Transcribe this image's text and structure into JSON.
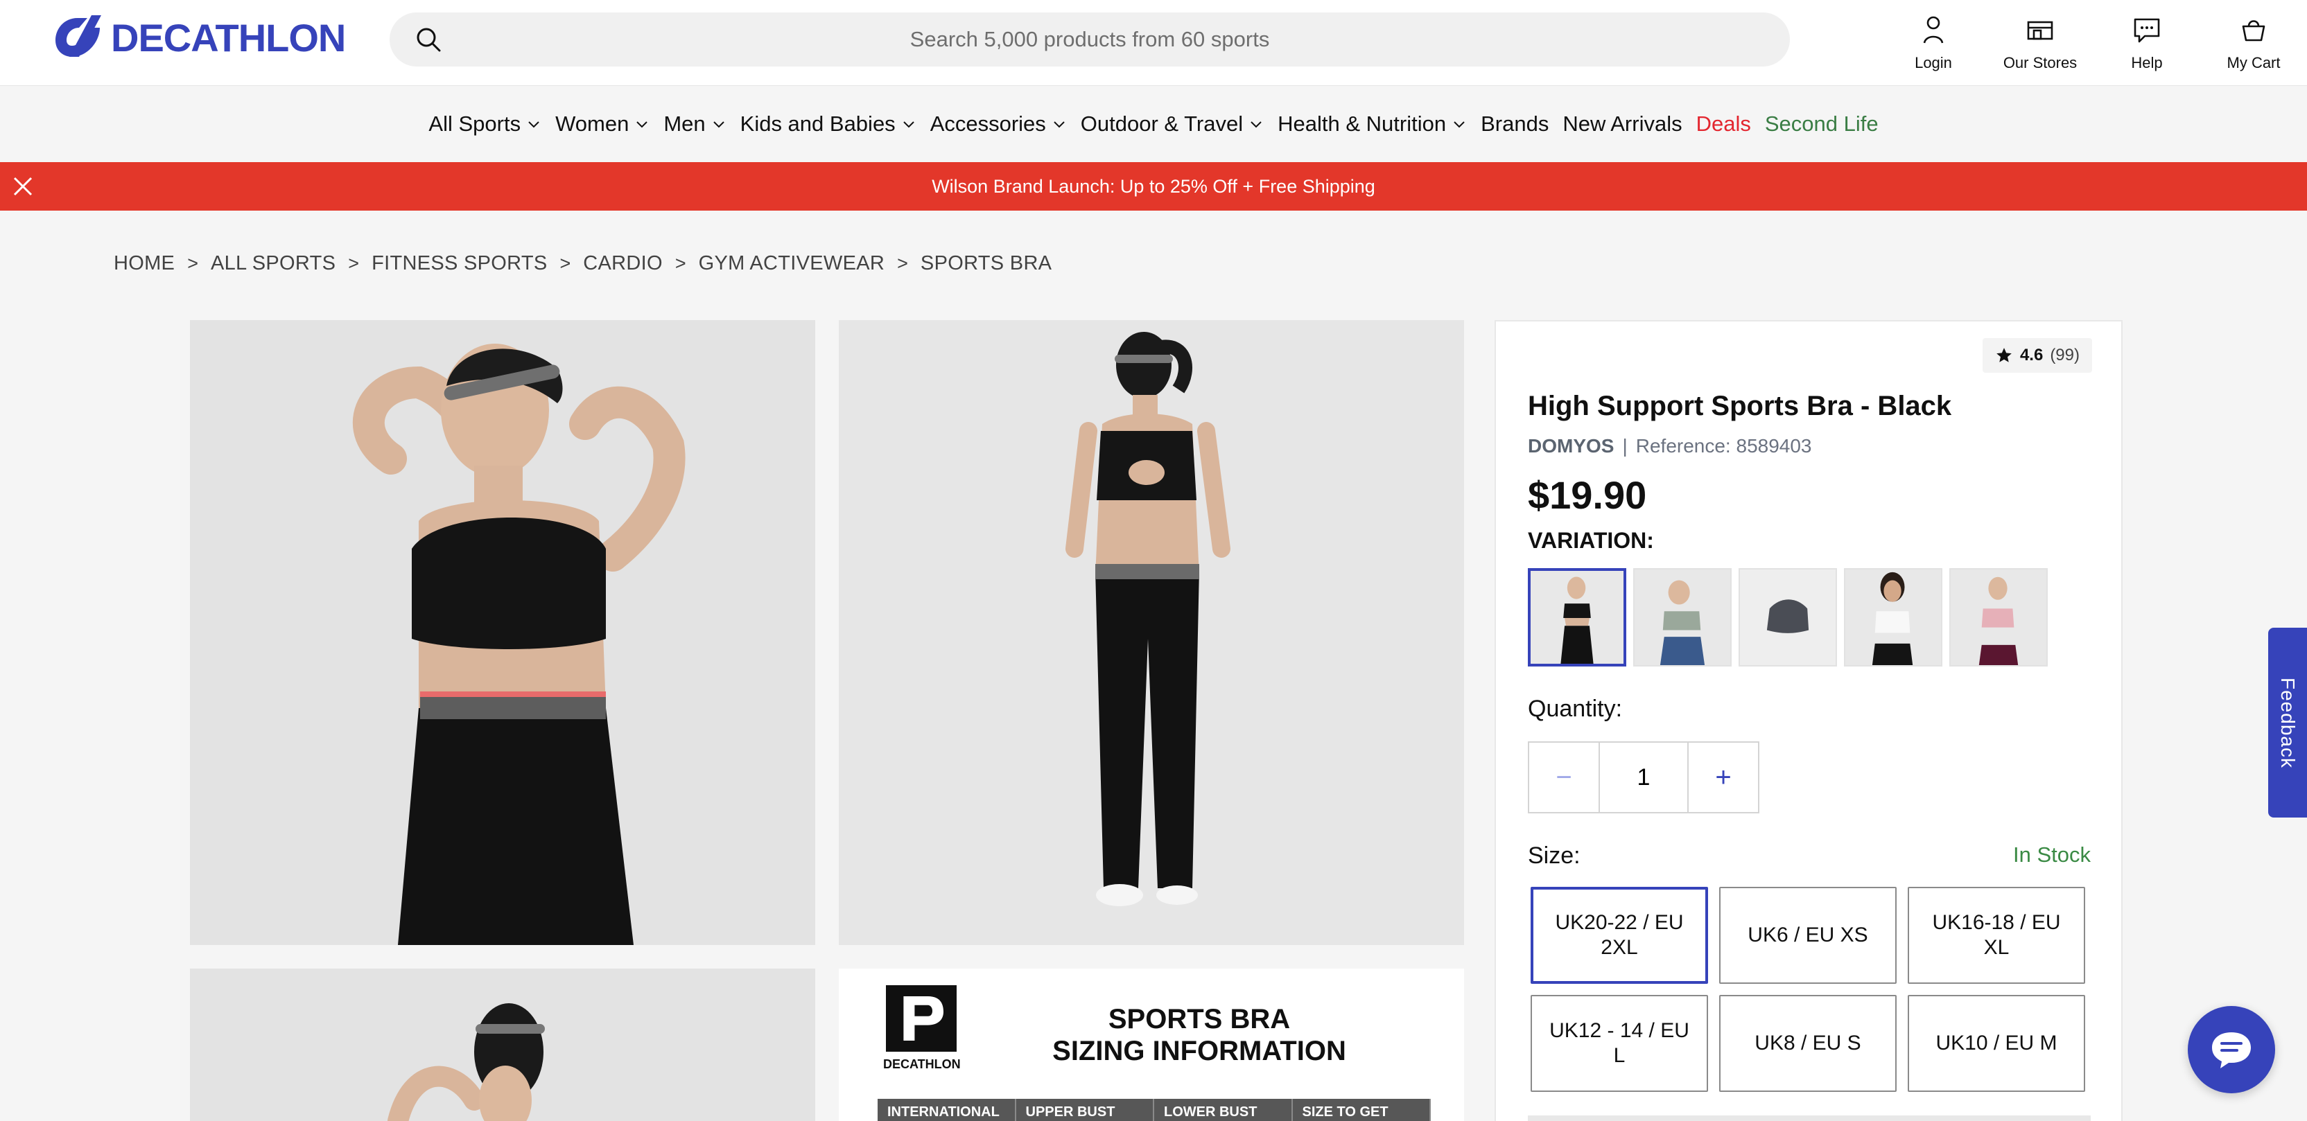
{
  "header": {
    "logo_text": "DECATHLON",
    "search_placeholder": "Search 5,000 products from 60 sports",
    "actions": [
      {
        "label": "Login",
        "icon": "user-icon"
      },
      {
        "label": "Our Stores",
        "icon": "store-icon"
      },
      {
        "label": "Help",
        "icon": "chat-bubble-icon"
      },
      {
        "label": "My Cart",
        "icon": "cart-icon"
      }
    ]
  },
  "nav": {
    "items": [
      {
        "label": "All Sports",
        "dropdown": true
      },
      {
        "label": "Women",
        "dropdown": true
      },
      {
        "label": "Men",
        "dropdown": true
      },
      {
        "label": "Kids and Babies",
        "dropdown": true
      },
      {
        "label": "Accessories",
        "dropdown": true
      },
      {
        "label": "Outdoor & Travel",
        "dropdown": true
      },
      {
        "label": "Health & Nutrition",
        "dropdown": true
      },
      {
        "label": "Brands",
        "dropdown": false
      },
      {
        "label": "New Arrivals",
        "dropdown": false
      },
      {
        "label": "Deals",
        "dropdown": false
      },
      {
        "label": "Second Life",
        "dropdown": false
      }
    ]
  },
  "promo": {
    "text": "Wilson Brand Launch: Up to 25% Off + Free Shipping"
  },
  "breadcrumb": [
    "HOME",
    "ALL SPORTS",
    "FITNESS SPORTS",
    "CARDIO",
    "GYM ACTIVEWEAR",
    "SPORTS BRA"
  ],
  "breadcrumb_separator": ">",
  "sizing_image": {
    "logo_text": "DECATHLON",
    "title_line1": "SPORTS BRA",
    "title_line2": "SIZING INFORMATION",
    "columns": [
      "INTERNATIONAL",
      "UPPER BUST",
      "LOWER BUST",
      "SIZE TO GET"
    ]
  },
  "product": {
    "rating": "4.6",
    "rating_count": "(99)",
    "title": "High Support Sports Bra - Black",
    "brand": "DOMYOS",
    "separator": "|",
    "reference": "Reference: 8589403",
    "price": "$19.90",
    "variation_label": "VARIATION:",
    "variations": [
      "black",
      "sage",
      "grey",
      "white",
      "pink"
    ],
    "quantity_label": "Quantity:",
    "quantity": "1",
    "minus": "−",
    "plus": "+",
    "size_label": "Size:",
    "stock_status": "In Stock",
    "sizes": [
      {
        "label": "UK20-22 / EU 2XL",
        "selected": true
      },
      {
        "label": "UK6 / EU XS",
        "selected": false
      },
      {
        "label": "UK16-18 / EU XL",
        "selected": false
      },
      {
        "label": "UK12 - 14 / EU L",
        "selected": false
      },
      {
        "label": "UK8 / EU S",
        "selected": false
      },
      {
        "label": "UK10 / EU M",
        "selected": false
      }
    ]
  },
  "feedback_label": "Feedback",
  "colors": {
    "brand": "#3643ba",
    "promo": "#e3372a",
    "deals": "#e3262f",
    "second_life": "#3a7d44",
    "in_stock": "#3a8a44"
  }
}
